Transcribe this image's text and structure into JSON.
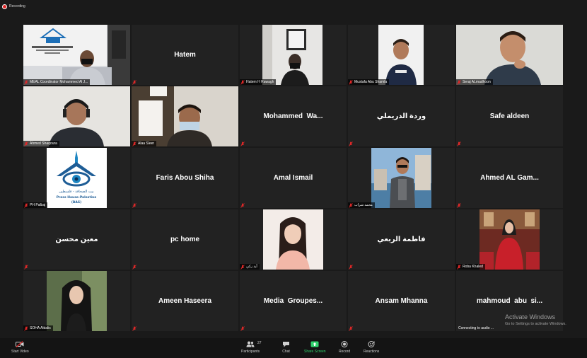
{
  "app": {
    "recording_label": "Recording",
    "activation": {
      "title": "Activate Windows",
      "subtitle": "Go to Settings to activate Windows."
    }
  },
  "participants": [
    {
      "tag": "MEAL Coordinator Mohammed Al J..."
    },
    {
      "big": "Hatem",
      "tag": ""
    },
    {
      "tag": "Hatem H Rawagh"
    },
    {
      "tag": "Mustafa Abu Shamla"
    },
    {
      "tag": "Seraj ALmadhoon"
    },
    {
      "tag": "Ahmed Shaqoura"
    },
    {
      "tag": "Alaa Sleer"
    },
    {
      "big": "Mohammed  Wa...",
      "tag": ""
    },
    {
      "big": "وردة الدريملي",
      "tag": ""
    },
    {
      "big": "Safe aldeen",
      "tag": ""
    },
    {
      "tag": "PH Palbaj",
      "logo_lines": [
        "بيت الصحافة - فلسطين",
        "Press House-Palestine",
        "(BAS)"
      ]
    },
    {
      "big": "Faris Abou Shiha",
      "tag": ""
    },
    {
      "big": "Amal Ismail",
      "tag": ""
    },
    {
      "tag": "محمد شراب"
    },
    {
      "big": "Ahmed AL Gam...",
      "tag": ""
    },
    {
      "big": "معين محسن",
      "tag": ""
    },
    {
      "big": "pc home",
      "tag": ""
    },
    {
      "tag": "آية زكي"
    },
    {
      "big": "فاطمة الربعي",
      "tag": ""
    },
    {
      "tag": "Roba Khaled"
    },
    {
      "tag": "SOHA Aldalis"
    },
    {
      "big": "Ameen Haseera",
      "tag": ""
    },
    {
      "big": "Media  Groupes...",
      "tag": ""
    },
    {
      "big": "Ansam Mhanna",
      "tag": ""
    },
    {
      "big": "mahmoud  abu  si...",
      "tag": "Connecting to audio ..."
    }
  ],
  "toolbar": {
    "start_video": "Start Video",
    "participants": "Participants",
    "participants_count": "27",
    "chat": "Chat",
    "share_screen": "Share Screen",
    "record": "Record",
    "reactions": "Reactions"
  },
  "colors": {
    "active_border": "#e6e24a",
    "share_green": "#2fd26c",
    "muted_red": "#e02828"
  }
}
